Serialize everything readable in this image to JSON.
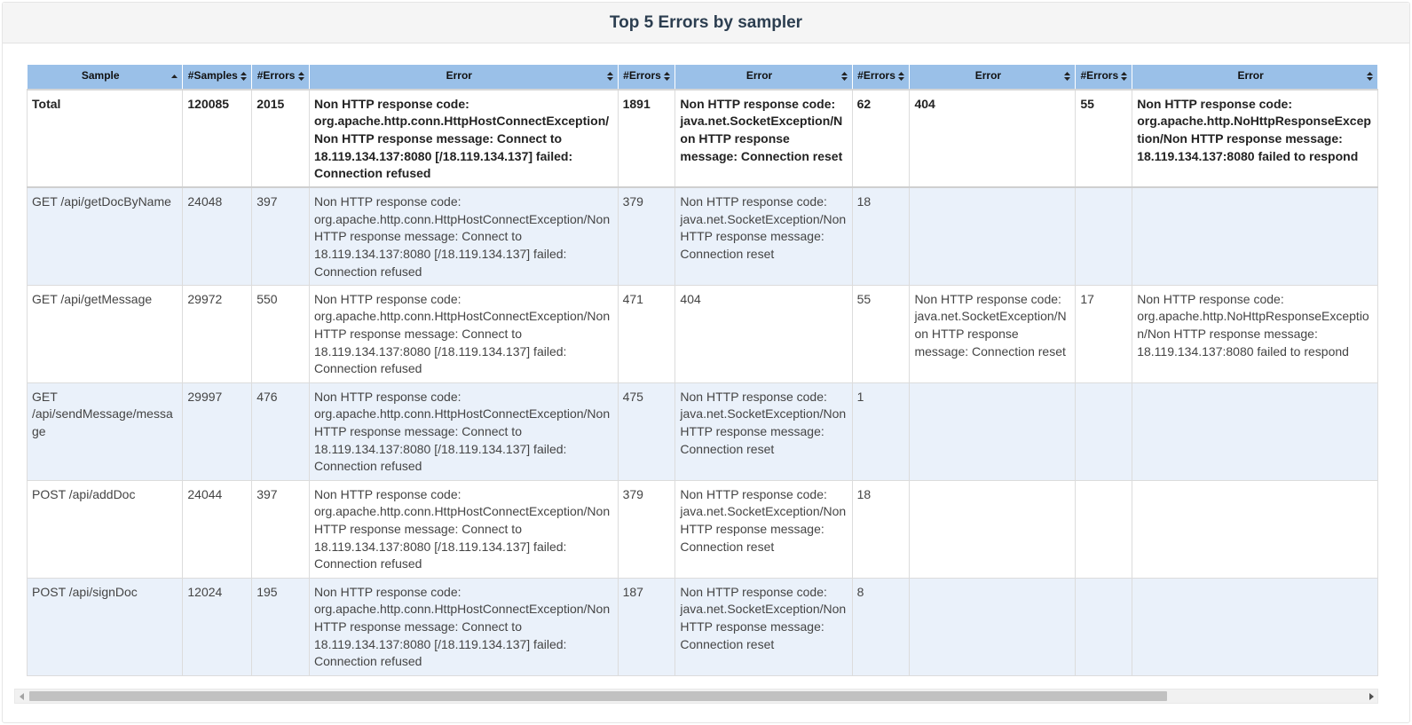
{
  "panel": {
    "title": "Top 5 Errors by sampler"
  },
  "table": {
    "headers": [
      "Sample",
      "#Samples",
      "#Errors",
      "Error",
      "#Errors",
      "Error",
      "#Errors",
      "Error",
      "#Errors",
      "Error"
    ],
    "sort_state": [
      "ascending",
      "none",
      "none",
      "none",
      "none",
      "none",
      "none",
      "none",
      "none",
      "none"
    ],
    "rows": [
      [
        "Total",
        "120085",
        "2015",
        "Non HTTP response code: org.apache.http.conn.HttpHostConnectException/Non HTTP response message: Connect to 18.119.134.137:8080 [/18.119.134.137] failed: Connection refused",
        "1891",
        "Non HTTP response code: java.net.SocketException/Non HTTP response message: Connection reset",
        "62",
        "404",
        "55",
        "Non HTTP response code: org.apache.http.NoHttpResponseException/Non HTTP response message: 18.119.134.137:8080 failed to respond"
      ],
      [
        "GET /api/getDocByName",
        "24048",
        "397",
        "Non HTTP response code: org.apache.http.conn.HttpHostConnectException/Non HTTP response message: Connect to 18.119.134.137:8080 [/18.119.134.137] failed: Connection refused",
        "379",
        "Non HTTP response code: java.net.SocketException/Non HTTP response message: Connection reset",
        "18",
        "",
        "",
        ""
      ],
      [
        "GET /api/getMessage",
        "29972",
        "550",
        "Non HTTP response code: org.apache.http.conn.HttpHostConnectException/Non HTTP response message: Connect to 18.119.134.137:8080 [/18.119.134.137] failed: Connection refused",
        "471",
        "404",
        "55",
        "Non HTTP response code: java.net.SocketException/Non HTTP response message: Connection reset",
        "17",
        "Non HTTP response code: org.apache.http.NoHttpResponseException/Non HTTP response message: 18.119.134.137:8080 failed to respond"
      ],
      [
        "GET /api/sendMessage/message",
        "29997",
        "476",
        "Non HTTP response code: org.apache.http.conn.HttpHostConnectException/Non HTTP response message: Connect to 18.119.134.137:8080 [/18.119.134.137] failed: Connection refused",
        "475",
        "Non HTTP response code: java.net.SocketException/Non HTTP response message: Connection reset",
        "1",
        "",
        "",
        ""
      ],
      [
        "POST /api/addDoc",
        "24044",
        "397",
        "Non HTTP response code: org.apache.http.conn.HttpHostConnectException/Non HTTP response message: Connect to 18.119.134.137:8080 [/18.119.134.137] failed: Connection refused",
        "379",
        "Non HTTP response code: java.net.SocketException/Non HTTP response message: Connection reset",
        "18",
        "",
        "",
        ""
      ],
      [
        "POST /api/signDoc",
        "12024",
        "195",
        "Non HTTP response code: org.apache.http.conn.HttpHostConnectException/Non HTTP response message: Connect to 18.119.134.137:8080 [/18.119.134.137] failed: Connection refused",
        "187",
        "Non HTTP response code: java.net.SocketException/Non HTTP response message: Connection reset",
        "8",
        "",
        "",
        ""
      ]
    ]
  },
  "scrollbar": {
    "horizontal_position": 0.0,
    "visible_fraction": 0.83
  },
  "colors": {
    "header_bg": "#9ac0e8",
    "stripe_bg": "#eaf1fa",
    "title": "#2c3e50"
  }
}
